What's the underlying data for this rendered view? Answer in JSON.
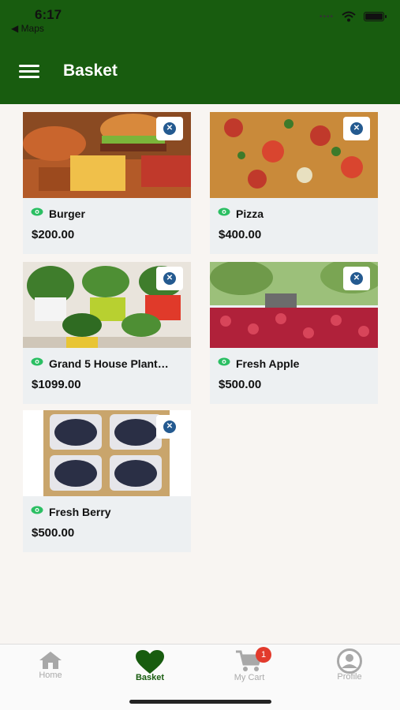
{
  "status_bar": {
    "time": "6:17",
    "back_label": "◀ Maps"
  },
  "header": {
    "title": "Basket"
  },
  "products": [
    {
      "name": "Burger",
      "price": "$200.00"
    },
    {
      "name": "Pizza",
      "price": "$400.00"
    },
    {
      "name": "Grand 5 House Plant…",
      "price": "$1099.00"
    },
    {
      "name": "Fresh Apple",
      "price": "$500.00"
    },
    {
      "name": "Fresh Berry",
      "price": "$500.00"
    }
  ],
  "tabs": [
    {
      "label": "Home",
      "icon": "home-icon"
    },
    {
      "label": "Basket",
      "icon": "heart-icon"
    },
    {
      "label": "My Cart",
      "icon": "cart-icon",
      "badge": "1"
    },
    {
      "label": "Profile",
      "icon": "profile-icon"
    }
  ],
  "colors": {
    "primary": "#185c0f",
    "badge": "#e23a2c",
    "remove": "#245a90",
    "eye": "#2bbf63"
  }
}
